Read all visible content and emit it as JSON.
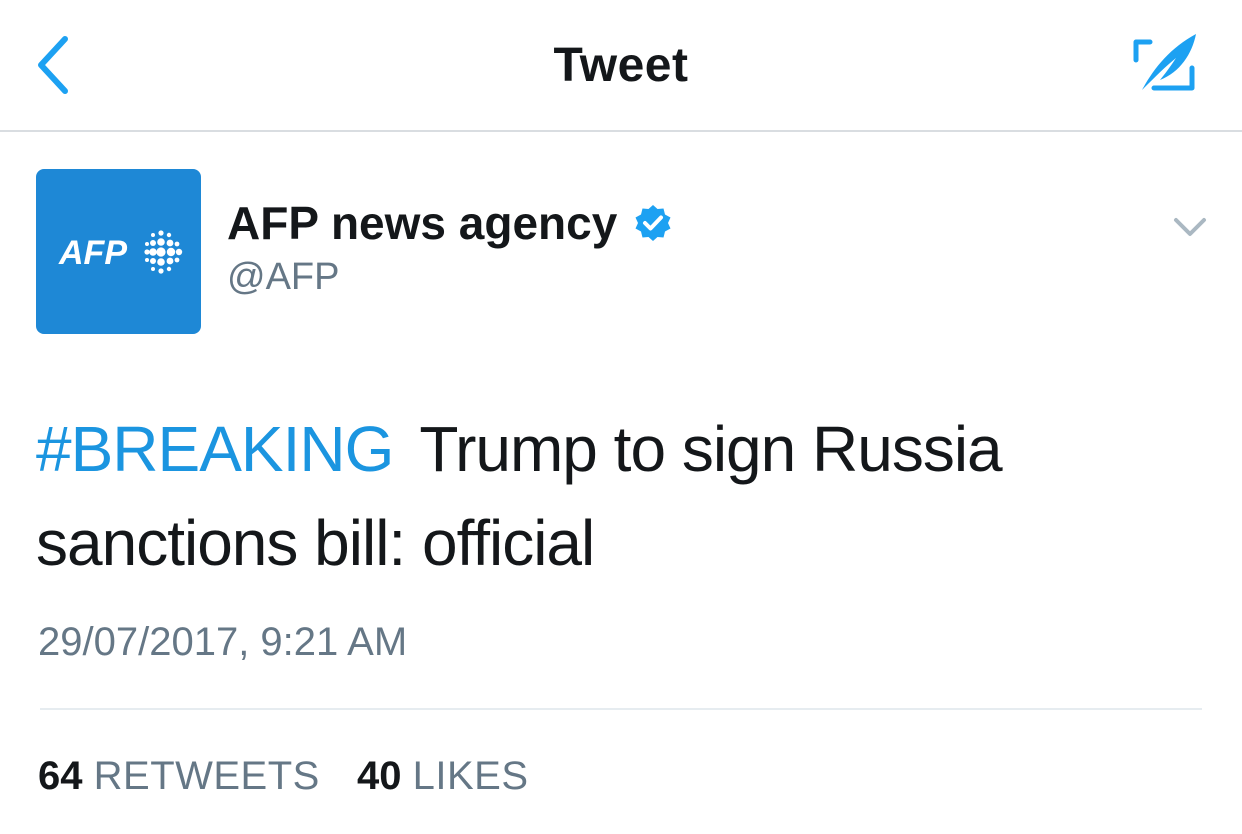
{
  "navbar": {
    "title": "Tweet",
    "back_icon": "chevron-left-icon",
    "compose_icon": "compose-tweet-icon",
    "accent_color": "#1da1f2"
  },
  "tweet": {
    "author": {
      "name": "AFP news agency",
      "handle": "@AFP",
      "verified": true,
      "avatar_text": "AFP",
      "avatar_color": "#1e88d6"
    },
    "hashtag": "#BREAKING",
    "text": "Trump to sign Russia sanctions bill: official",
    "timestamp": "29/07/2017, 9:21 AM",
    "stats": {
      "retweets_count": "64",
      "retweets_label": "RETWEETS",
      "likes_count": "40",
      "likes_label": "LIKES"
    }
  }
}
